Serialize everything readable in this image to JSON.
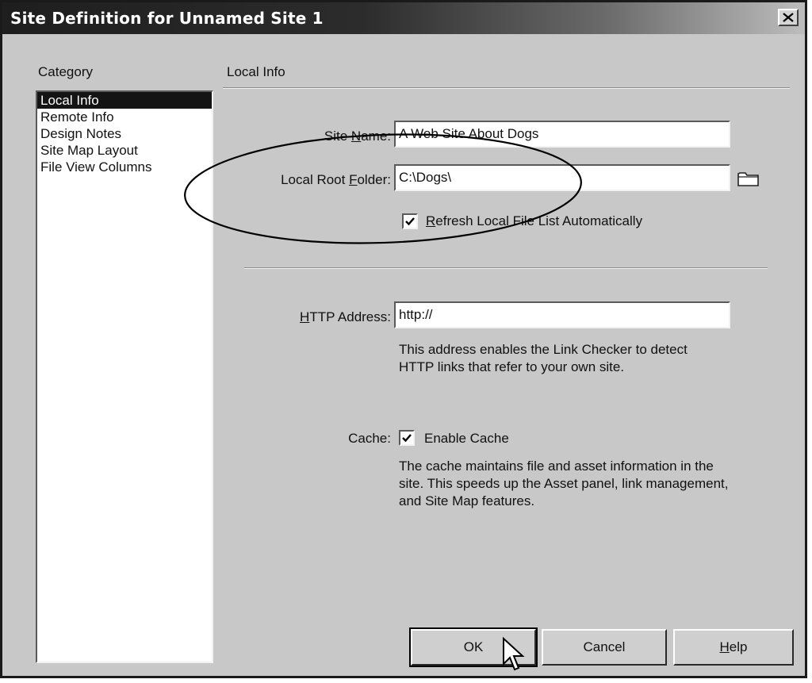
{
  "window": {
    "title": "Site Definition for Unnamed Site 1",
    "close_glyph": "✕"
  },
  "category": {
    "label": "Category",
    "items": [
      "Local Info",
      "Remote Info",
      "Design Notes",
      "Site Map Layout",
      "File View Columns"
    ],
    "selected": "Local Info"
  },
  "panel": {
    "title": "Local Info"
  },
  "form": {
    "site_name": {
      "label_pre": "Site ",
      "label_key": "N",
      "label_post": "ame:",
      "value": "A Web Site About Dogs"
    },
    "local_root": {
      "label_pre": "Local Root ",
      "label_key": "F",
      "label_post": "older:",
      "value": "C:\\Dogs\\",
      "browse_icon": "folder-icon"
    },
    "refresh": {
      "label_key": "R",
      "label_post": "efresh Local File List Automatically",
      "checked": true
    },
    "http": {
      "label_key": "H",
      "label_post": "TTP Address:",
      "value": "http://",
      "description": "This address enables the Link Checker to detect HTTP links that refer to your own site."
    },
    "cache": {
      "label": "Cache:",
      "checkbox_label": "Enable Cache",
      "checked": true,
      "description": "The cache maintains file and asset information in the site.  This speeds up the Asset panel, link management, and Site Map features."
    }
  },
  "buttons": {
    "ok": "OK",
    "cancel": "Cancel",
    "help_key": "H",
    "help_post": "elp"
  },
  "annotation": {
    "shape": "ellipse",
    "color": "#000000"
  }
}
